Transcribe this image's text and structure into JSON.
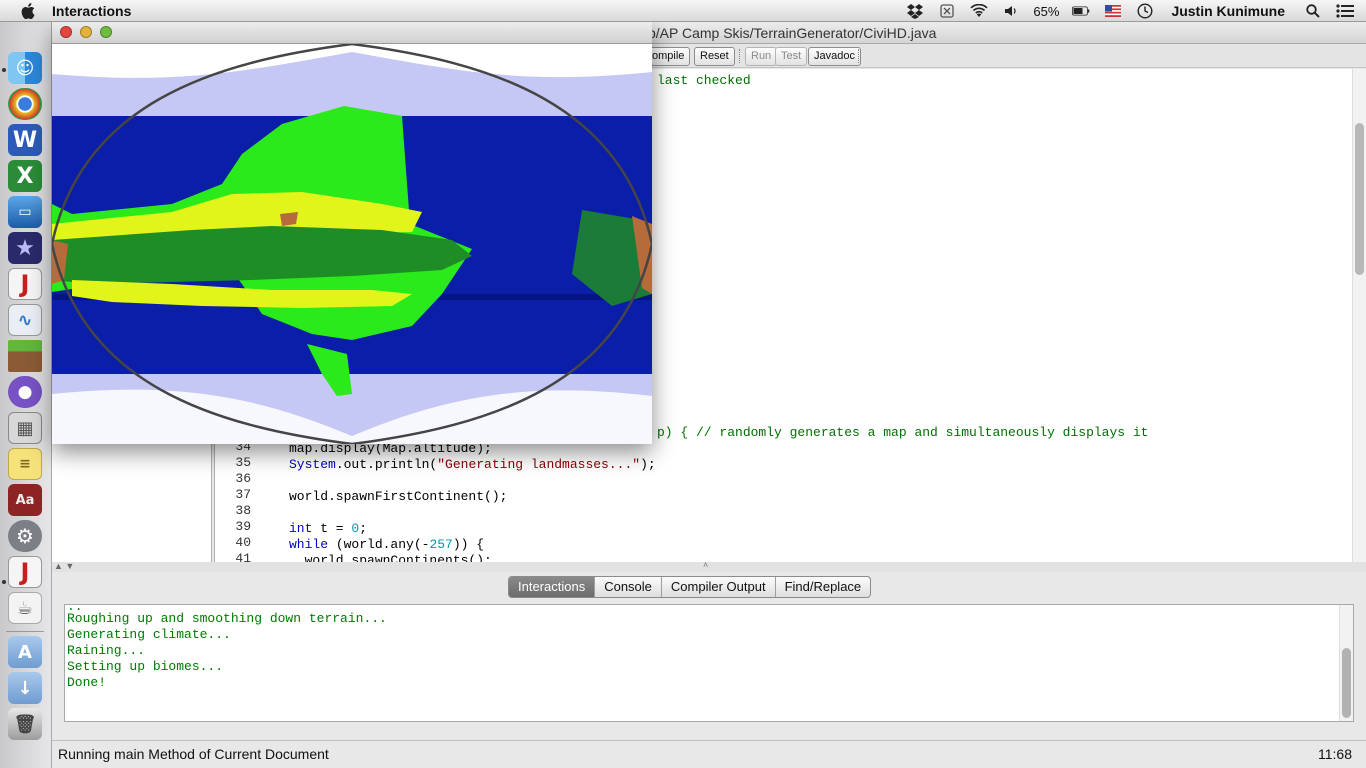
{
  "menubar": {
    "app_name": "Interactions",
    "battery": "65%",
    "user": "Justin Kunimune",
    "icons": [
      "apple-icon",
      "dropbox-icon",
      "sync-icon",
      "wifi-icon",
      "volume-icon",
      "battery-icon",
      "flag-icon",
      "clock-icon",
      "spotlight-icon",
      "list-icon"
    ]
  },
  "dock": {
    "items": [
      "finder",
      "chrome",
      "word",
      "excel",
      "keynote",
      "imovie",
      "drjava",
      "grapher",
      "minecraft",
      "github",
      "calculator",
      "stickies",
      "dictionary",
      "system-preferences",
      "drjava-running",
      "java-app",
      "applications",
      "downloads",
      "trash"
    ]
  },
  "ide": {
    "window_title": "p/AP Camp Skis/TerrainGenerator/CiviHD.java",
    "toolbar": {
      "compile": "ompile",
      "reset": "Reset",
      "run": "Run",
      "test": "Test",
      "javadoc": "Javadoc"
    },
    "editor": {
      "header_comment": "last checked",
      "line33_tail": "p) { // randomly generates a map and simultaneously displays it",
      "lines": [
        {
          "num": "34",
          "text": "map.display(Map.altitude);"
        },
        {
          "num": "35",
          "pre": "System",
          "mid": ".out.println(",
          "str": "\"Generating landmasses...\"",
          "post": ");"
        },
        {
          "num": "36",
          "text": ""
        },
        {
          "num": "37",
          "text": "world.spawnFirstContinent();"
        },
        {
          "num": "38",
          "text": ""
        },
        {
          "num": "39",
          "kw": "int",
          "mid": " t = ",
          "n": "0",
          "post": ";"
        },
        {
          "num": "40",
          "kw": "while",
          "mid": " (world.any(-",
          "n": "257",
          "post": ")) {"
        },
        {
          "num": "41",
          "text": "  world.spawnContinents();"
        }
      ]
    },
    "bottom_tabs": [
      "Interactions",
      "Console",
      "Compiler Output",
      "Find/Replace"
    ],
    "active_tab": "Interactions",
    "output_lines": [
      "Roughing up and smoothing down terrain...",
      "Generating climate...",
      "Raining...",
      "Setting up biomes...",
      "Done!"
    ],
    "status_message": "Running main Method of Current Document",
    "cursor_position": "11:68"
  },
  "map_window": {
    "colors": {
      "ice": "#ffffff",
      "tundra": "#c5c7f4",
      "ocean": "#0b1ea8",
      "deep_ocean": "#061584",
      "grassland": "#2bea1b",
      "forest": "#1e8d26",
      "desert": "#e2f51a",
      "mountain": "#b56b3a",
      "outline": "#454545"
    }
  }
}
